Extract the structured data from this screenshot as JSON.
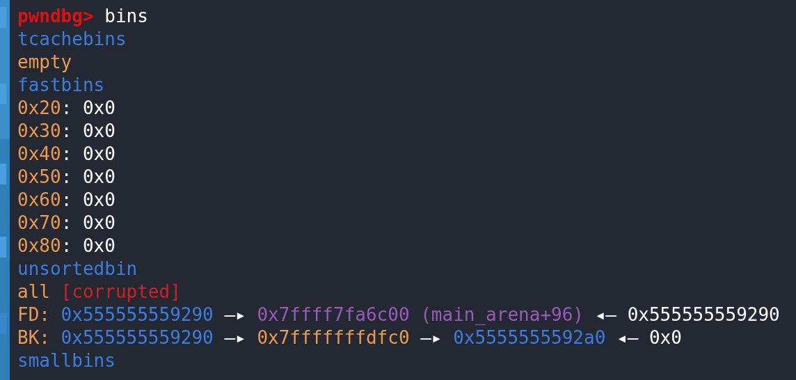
{
  "terminal": {
    "lines": [
      [
        {
          "kind": "prompt",
          "text": "pwndbg>"
        },
        {
          "kind": "text",
          "text": " bins"
        }
      ],
      [
        {
          "kind": "heading",
          "text": "tcachebins"
        }
      ],
      [
        {
          "kind": "key",
          "text": "empty"
        }
      ],
      [
        {
          "kind": "heading",
          "text": "fastbins"
        }
      ],
      [
        {
          "kind": "key",
          "text": "0x20"
        },
        {
          "kind": "text",
          "text": ": 0x0"
        }
      ],
      [
        {
          "kind": "key",
          "text": "0x30"
        },
        {
          "kind": "text",
          "text": ": 0x0"
        }
      ],
      [
        {
          "kind": "key",
          "text": "0x40"
        },
        {
          "kind": "text",
          "text": ": 0x0"
        }
      ],
      [
        {
          "kind": "key",
          "text": "0x50"
        },
        {
          "kind": "text",
          "text": ": 0x0"
        }
      ],
      [
        {
          "kind": "key",
          "text": "0x60"
        },
        {
          "kind": "text",
          "text": ": 0x0"
        }
      ],
      [
        {
          "kind": "key",
          "text": "0x70"
        },
        {
          "kind": "text",
          "text": ": 0x0"
        }
      ],
      [
        {
          "kind": "key",
          "text": "0x80"
        },
        {
          "kind": "text",
          "text": ": 0x0"
        }
      ],
      [
        {
          "kind": "heading",
          "text": "unsortedbin"
        }
      ],
      [
        {
          "kind": "key",
          "text": "all"
        },
        {
          "kind": "error",
          "text": " [corrupted]"
        }
      ],
      [
        {
          "kind": "key",
          "text": "FD:"
        },
        {
          "kind": "heap",
          "text": " 0x555555559290"
        },
        {
          "kind": "text",
          "text": " —▸"
        },
        {
          "kind": "libc",
          "text": " 0x7ffff7fa6c00 (main_arena+96)"
        },
        {
          "kind": "text",
          "text": " ◂— 0x555555559290"
        }
      ],
      [
        {
          "kind": "key",
          "text": "BK:"
        },
        {
          "kind": "heap",
          "text": " 0x555555559290"
        },
        {
          "kind": "text",
          "text": " —▸"
        },
        {
          "kind": "stack",
          "text": " 0x7fffffffdfc0"
        },
        {
          "kind": "text",
          "text": " —▸"
        },
        {
          "kind": "heap",
          "text": " 0x5555555592a0"
        },
        {
          "kind": "text",
          "text": " ◂— 0x0"
        }
      ],
      [
        {
          "kind": "heading",
          "text": "smallbins"
        }
      ]
    ]
  }
}
